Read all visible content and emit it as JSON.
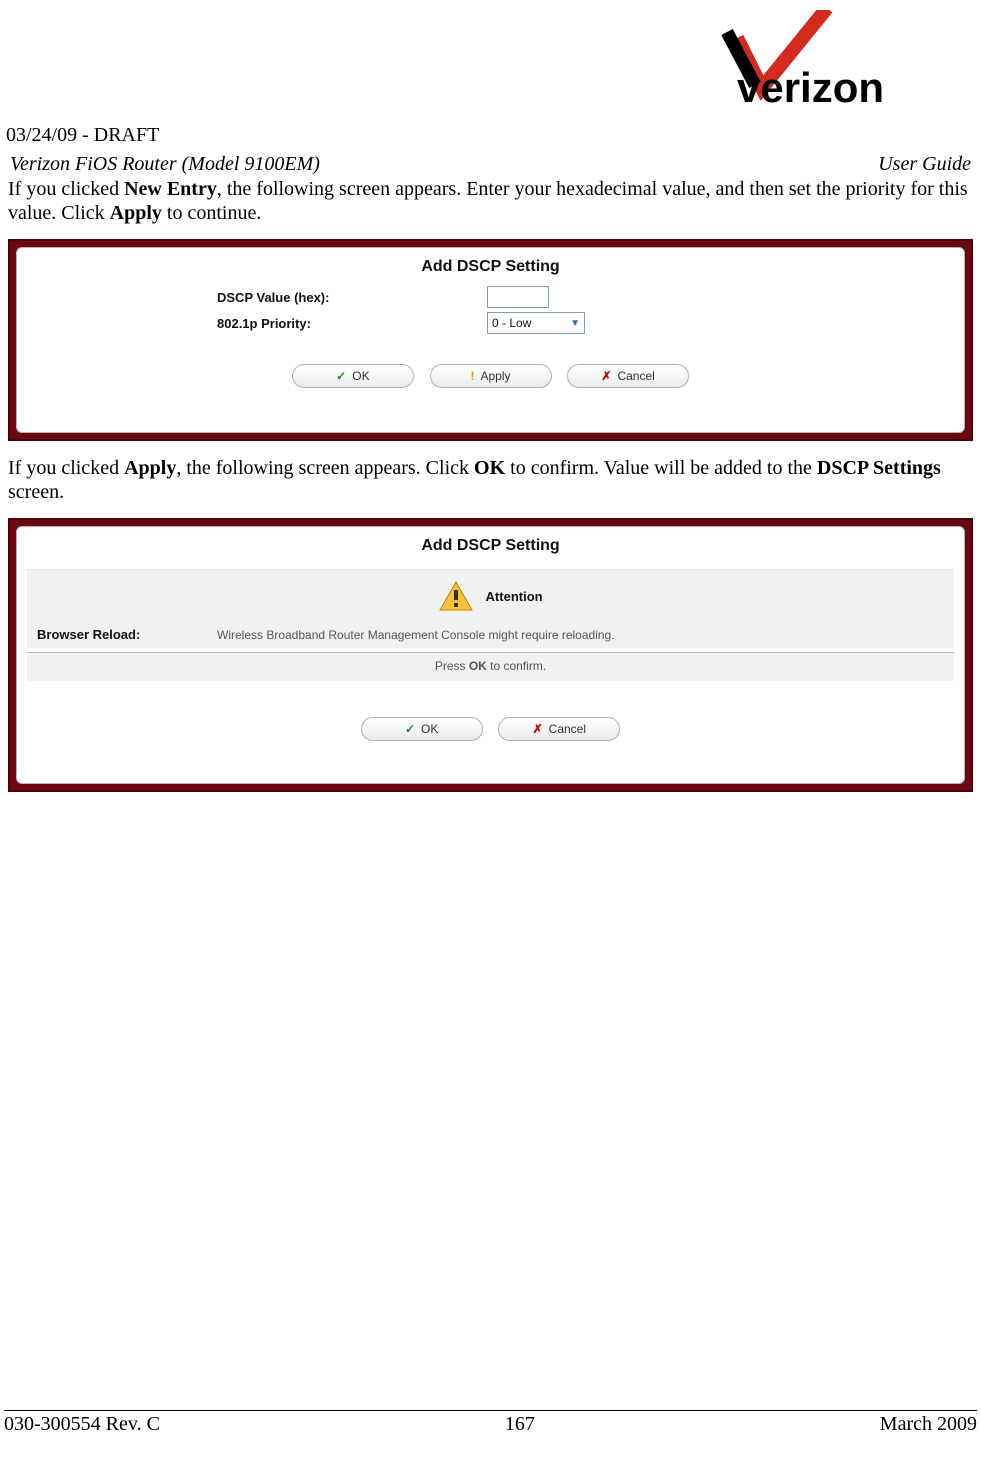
{
  "logo_text": "verizon",
  "draft": "03/24/09 - DRAFT",
  "header": {
    "left": "Verizon FiOS Router (Model 9100EM)",
    "right": "User Guide"
  },
  "para1": {
    "t1": "If you clicked ",
    "b1": "New Entry",
    "t2": ", the following screen appears. Enter your hexadecimal value, and then set the priority for this value. Click ",
    "b2": "Apply",
    "t3": " to continue."
  },
  "panel1": {
    "title": "Add DSCP Setting",
    "field1_label": "DSCP Value (hex):",
    "field1_value": "",
    "field2_label": "802.1p Priority:",
    "field2_value": "0 - Low",
    "buttons": {
      "ok": "OK",
      "apply": "Apply",
      "cancel": "Cancel"
    }
  },
  "para2": {
    "t1": "If you clicked ",
    "b1": "Apply",
    "t2": ", the following screen appears. Click ",
    "b2": "OK",
    "t3": " to confirm. Value will be added to the ",
    "b3": "DSCP Settings",
    "t4": " screen."
  },
  "panel2": {
    "title": "Add DSCP Setting",
    "attention": "Attention",
    "reload_label": "Browser Reload:",
    "reload_msg": "Wireless Broadband Router Management Console might require reloading.",
    "confirm_pre": "Press ",
    "confirm_bold": "OK",
    "confirm_post": " to confirm.",
    "buttons": {
      "ok": "OK",
      "cancel": "Cancel"
    }
  },
  "footer": {
    "left": "030-300554 Rev. C",
    "center": "167",
    "right": "March 2009"
  }
}
